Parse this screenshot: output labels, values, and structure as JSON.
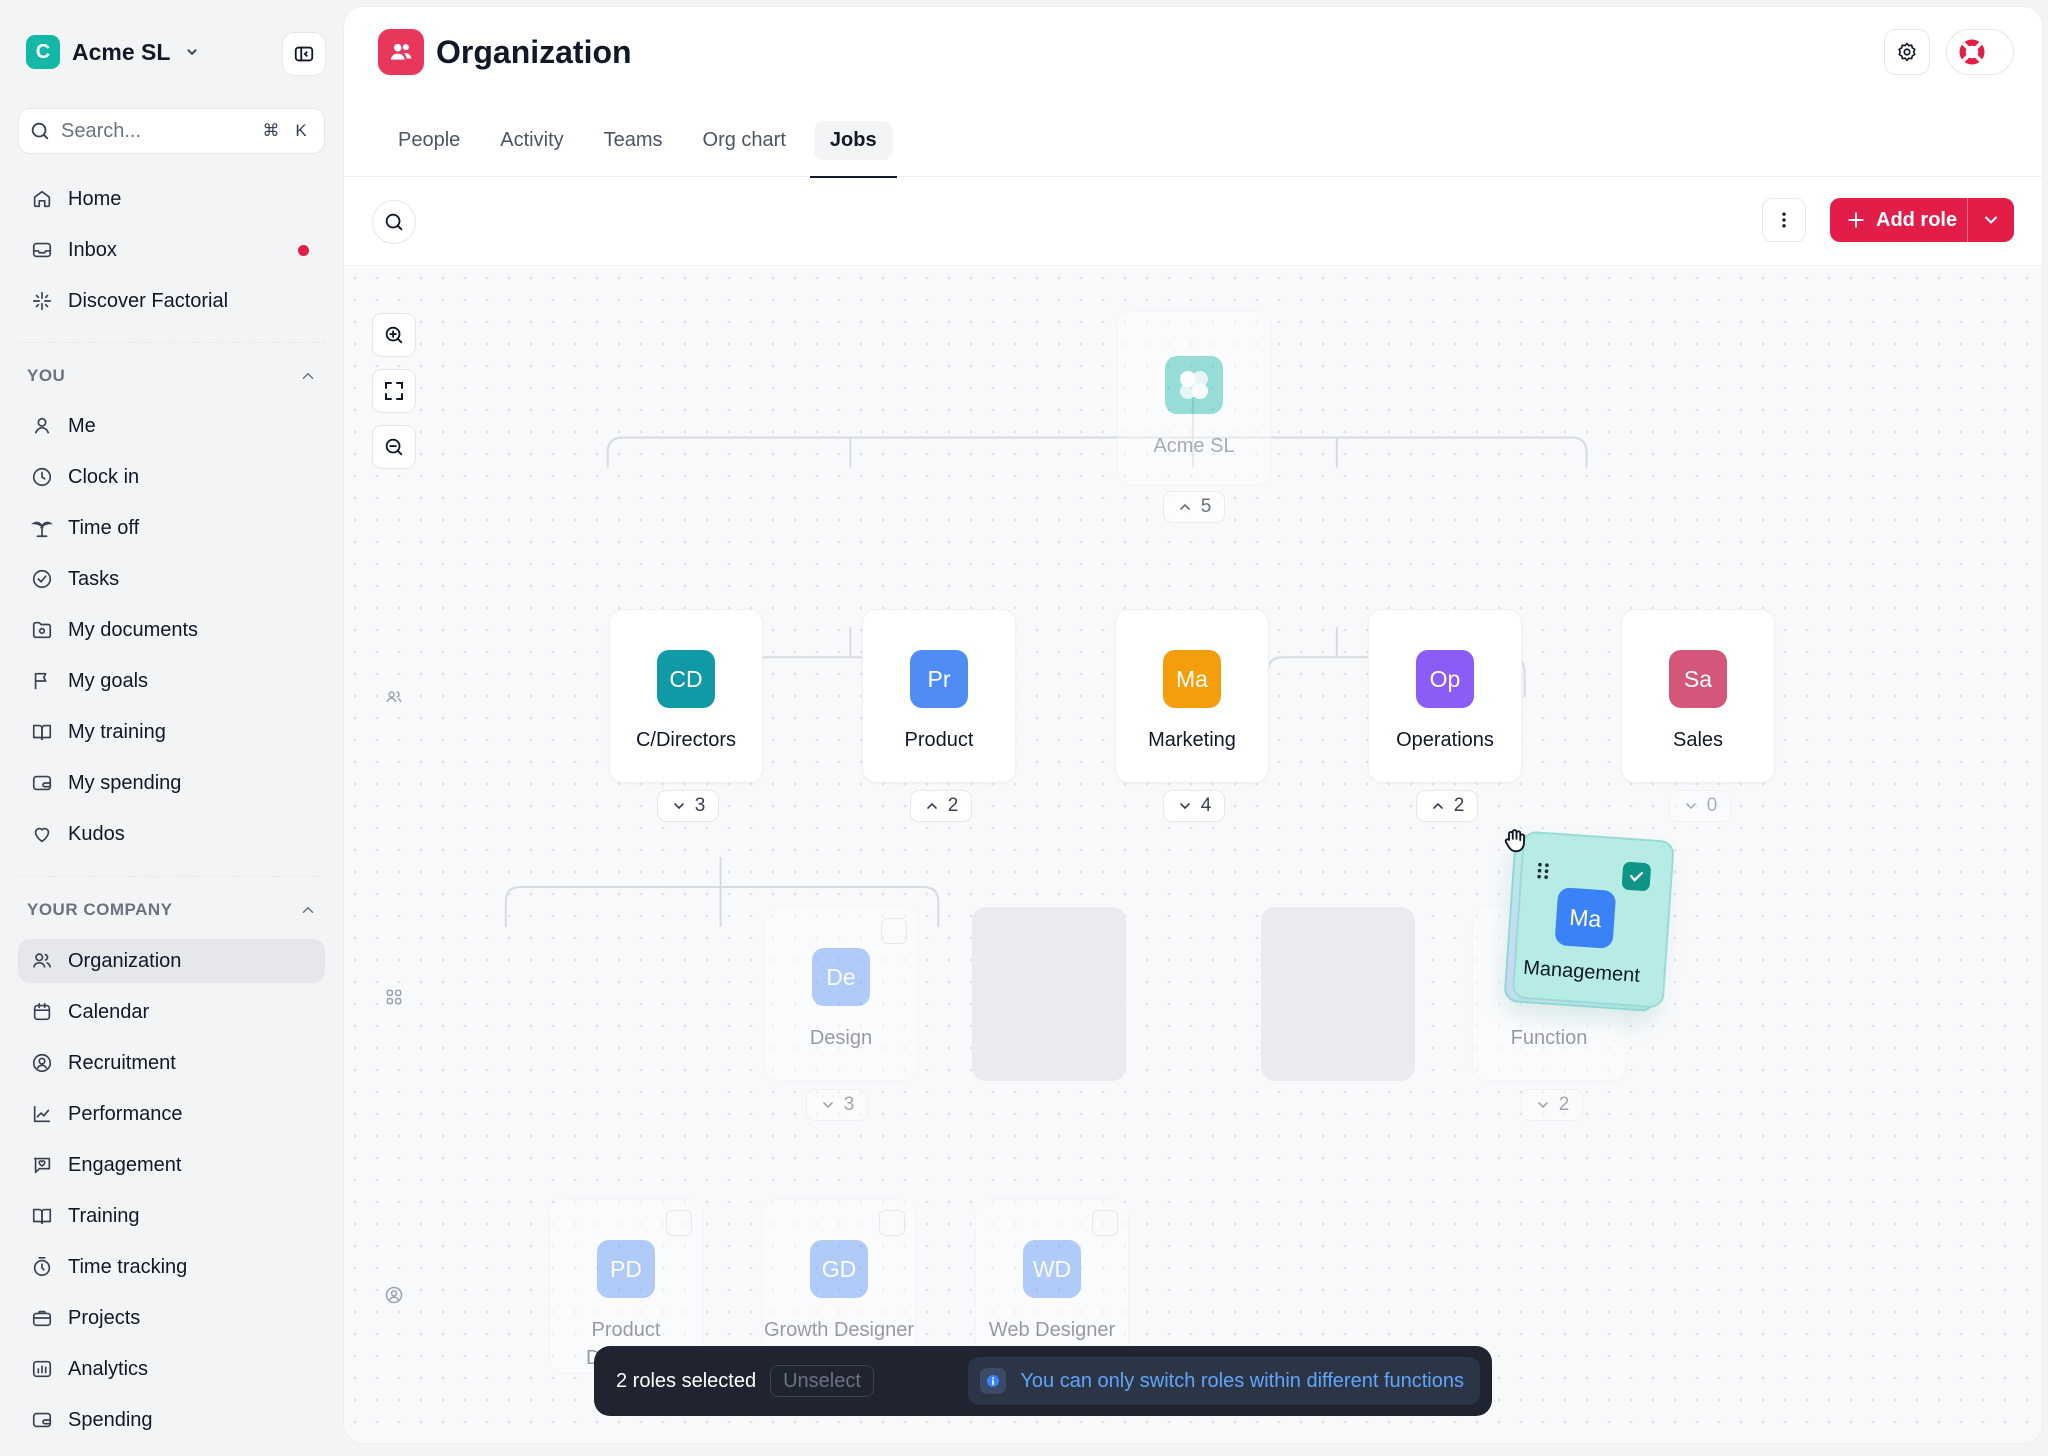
{
  "sidebar": {
    "company": {
      "initial": "C",
      "name": "Acme SL"
    },
    "search": {
      "placeholder": "Search...",
      "shortcut_cmd": "⌘",
      "shortcut_key": "K"
    },
    "top_items": [
      {
        "label": "Home",
        "icon": "home-icon"
      },
      {
        "label": "Inbox",
        "icon": "inbox-icon",
        "badge": true
      },
      {
        "label": "Discover Factorial",
        "icon": "sparkle-icon"
      }
    ],
    "you_label": "YOU",
    "you_items": [
      {
        "label": "Me",
        "icon": "person-icon"
      },
      {
        "label": "Clock in",
        "icon": "clock-icon"
      },
      {
        "label": "Time off",
        "icon": "palm-tree-icon"
      },
      {
        "label": "Tasks",
        "icon": "check-circle-icon"
      },
      {
        "label": "My documents",
        "icon": "folder-icon"
      },
      {
        "label": "My goals",
        "icon": "flag-icon"
      },
      {
        "label": "My training",
        "icon": "book-icon"
      },
      {
        "label": "My spending",
        "icon": "wallet-icon"
      },
      {
        "label": "Kudos",
        "icon": "heart-icon"
      }
    ],
    "company_label": "YOUR COMPANY",
    "company_items": [
      {
        "label": "Organization",
        "icon": "people-icon",
        "active": true
      },
      {
        "label": "Calendar",
        "icon": "calendar-icon"
      },
      {
        "label": "Recruitment",
        "icon": "recruit-icon"
      },
      {
        "label": "Performance",
        "icon": "chart-icon"
      },
      {
        "label": "Engagement",
        "icon": "chat-heart-icon"
      },
      {
        "label": "Training",
        "icon": "book-icon"
      },
      {
        "label": "Time tracking",
        "icon": "stopwatch-icon"
      },
      {
        "label": "Projects",
        "icon": "briefcase-icon"
      },
      {
        "label": "Analytics",
        "icon": "analytics-icon"
      },
      {
        "label": "Spending",
        "icon": "wallet-icon"
      }
    ]
  },
  "header": {
    "title": "Organization",
    "tabs": [
      {
        "label": "People"
      },
      {
        "label": "Activity"
      },
      {
        "label": "Teams"
      },
      {
        "label": "Org chart"
      },
      {
        "label": "Jobs",
        "active": true
      }
    ]
  },
  "toolbar": {
    "add_role_label": "Add role"
  },
  "org": {
    "root": {
      "name": "Acme SL",
      "count": "5"
    },
    "functions": [
      {
        "initials": "CD",
        "name": "C/Directors",
        "count": "3",
        "color": "#0f9aa6",
        "expanded": false
      },
      {
        "initials": "Pr",
        "name": "Product",
        "count": "2",
        "color": "#4f8df5",
        "expanded": true
      },
      {
        "initials": "Ma",
        "name": "Marketing",
        "count": "4",
        "color": "#f59e0b",
        "expanded": false
      },
      {
        "initials": "Op",
        "name": "Operations",
        "count": "2",
        "color": "#8b5cf6",
        "expanded": true
      },
      {
        "initials": "Sa",
        "name": "Sales",
        "count": "0",
        "color": "#d4567a",
        "expanded": false
      }
    ],
    "subfunctions": [
      {
        "initials": "De",
        "name": "Design",
        "count": "3",
        "color": "#4f8df5"
      },
      {
        "initials": "",
        "name": "Function",
        "count": "2",
        "color": "#4f8df5"
      }
    ],
    "roles": [
      {
        "initials": "PD",
        "name": "Product Designer",
        "color": "#4f8df5"
      },
      {
        "initials": "GD",
        "name": "Growth Designer",
        "color": "#4f8df5"
      },
      {
        "initials": "WD",
        "name": "Web Designer",
        "color": "#4f8df5"
      }
    ],
    "dragging": {
      "initials": "Ma",
      "name": "Management"
    }
  },
  "selection": {
    "summary": "2 roles selected",
    "unselect_label": "Unselect",
    "notice": "You can only switch roles within different functions"
  },
  "colors": {
    "brand": "#e11d48",
    "teal": "#14b8a6"
  }
}
